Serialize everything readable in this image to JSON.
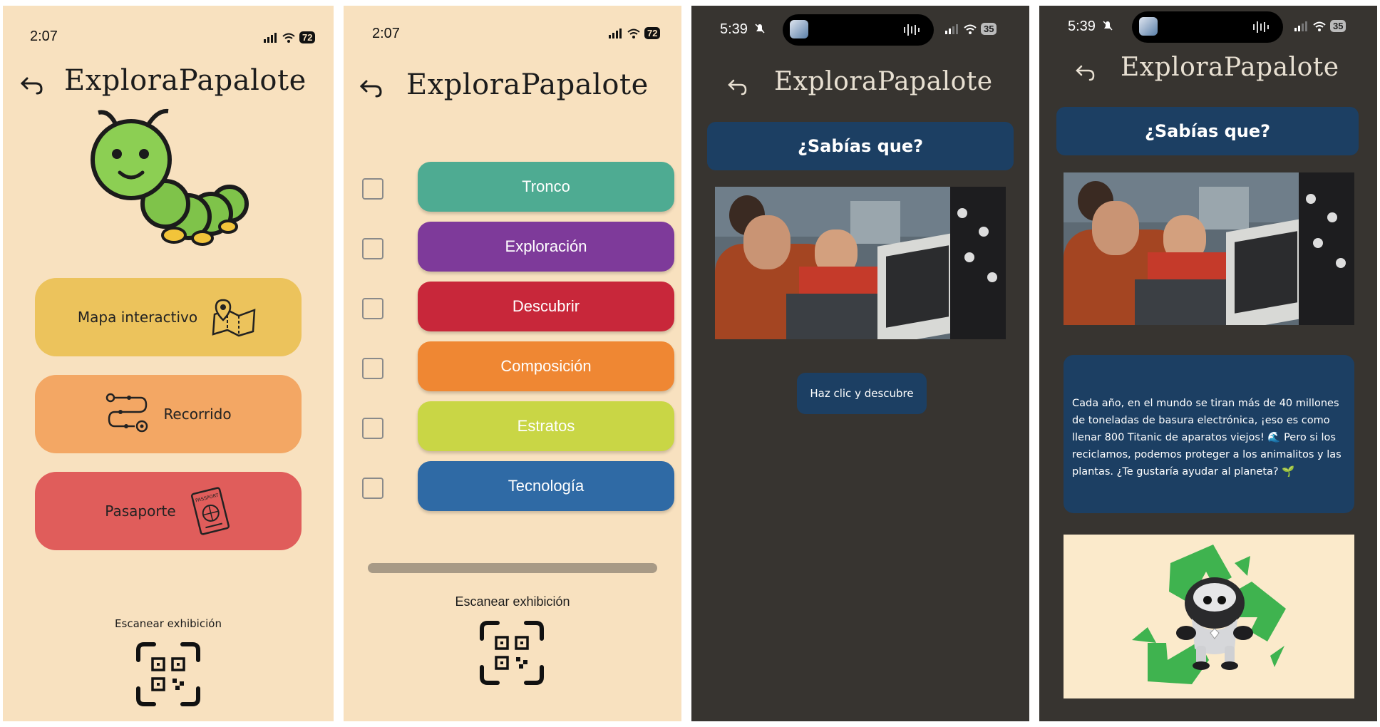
{
  "screen1": {
    "status_time": "2:07",
    "battery": "72",
    "title": "ExploraPapalote",
    "buttons": {
      "map": "Mapa interactivo",
      "tour": "Recorrido",
      "passport": "Pasaporte"
    },
    "passport_stamp": "PASSPORT",
    "scan_label": "Escanear exhibición",
    "colors": {
      "background": "#f8e1bf",
      "map": "#ecc35c",
      "tour": "#f3a764",
      "passport": "#e05d5b"
    }
  },
  "screen2": {
    "status_time": "2:07",
    "battery": "72",
    "title": "ExploraPapalote",
    "categories": [
      {
        "label": "Tronco",
        "color": "#4eab92",
        "checked": false
      },
      {
        "label": "Exploración",
        "color": "#7e3a9a",
        "checked": false
      },
      {
        "label": "Descubrir",
        "color": "#c8273a",
        "checked": false
      },
      {
        "label": "Composición",
        "color": "#ef8733",
        "checked": false
      },
      {
        "label": "Estratos",
        "color": "#c9d645",
        "checked": false
      },
      {
        "label": "Tecnología",
        "color": "#2f6aa5",
        "checked": false
      }
    ],
    "scan_label": "Escanear exhibición"
  },
  "screen3": {
    "status_time": "5:39",
    "battery": "35",
    "title": "ExploraPapalote",
    "banner": "¿Sabías que?",
    "cta_button": "Haz clic y descubre",
    "colors": {
      "background": "#373430",
      "banner": "#1c3f63"
    }
  },
  "screen4": {
    "status_time": "5:39",
    "battery": "35",
    "title": "ExploraPapalote",
    "banner": "¿Sabías que?",
    "fact_text": "Cada año, en el mundo se tiran más de 40 millones de toneladas de basura electrónica, ¡eso es como llenar 800 Titanic de aparatos viejos! 🌊 Pero si los reciclamos, podemos proteger a los animalitos y las plantas. ¿Te gustaría ayudar al planeta? 🌱"
  }
}
